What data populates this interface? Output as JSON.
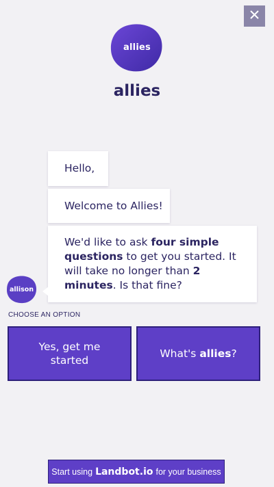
{
  "header": {
    "close_icon": "close-icon",
    "logo_text": "allies",
    "title": "allies"
  },
  "chat": {
    "messages": [
      {
        "text": "Hello,"
      },
      {
        "text": "Welcome to Allies!"
      },
      {
        "parts": [
          "We'd like to ask ",
          "four simple questions",
          " to get you started. It will take no longer than ",
          "2 minutes",
          ". Is that fine?"
        ]
      }
    ],
    "bot_avatar_text": "allison"
  },
  "options": {
    "label": "CHOOSE AN OPTION",
    "yes_label": "Yes, get me started",
    "what_prefix": "What's ",
    "what_bold": "allies",
    "what_suffix": "?"
  },
  "footer": {
    "prefix": "Start using ",
    "brand": "Landbot.io",
    "suffix": " for your business"
  },
  "colors": {
    "background": "#f2f1f4",
    "accent": "#5e3fc7",
    "accent_dark": "#2d1f7a",
    "text_dark": "#2b2461",
    "close_bg": "#8a85a8"
  }
}
